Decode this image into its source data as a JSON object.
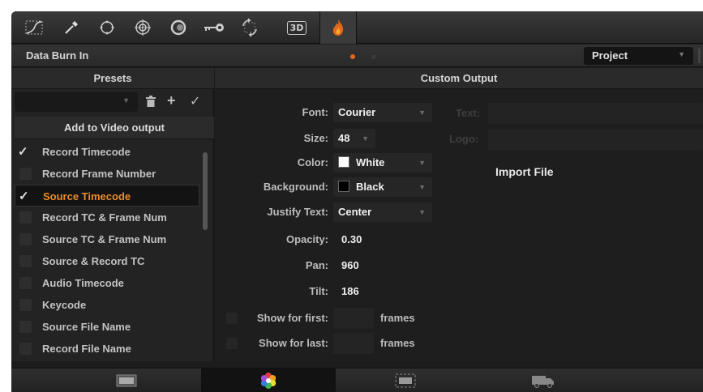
{
  "toolbar": {
    "tools": [
      {
        "icon": "curves-icon"
      },
      {
        "icon": "eyedropper-icon"
      },
      {
        "icon": "window-icon"
      },
      {
        "icon": "tracker-icon"
      },
      {
        "icon": "blur-icon"
      },
      {
        "icon": "key-icon"
      },
      {
        "icon": "sizing-icon"
      },
      {
        "icon": "stereo-3d-icon",
        "label": "3D"
      },
      {
        "icon": "flame-icon"
      }
    ],
    "active_tool": "flame-icon"
  },
  "panel": {
    "title": "Data Burn In",
    "scope_select": "Project"
  },
  "presets": {
    "header": "Presets",
    "selected": ""
  },
  "video_output": {
    "header": "Add to Video output",
    "items": [
      {
        "label": "Record Timecode",
        "checked": true
      },
      {
        "label": "Record Frame Number",
        "checked": false
      },
      {
        "label": "Source Timecode",
        "checked": true
      },
      {
        "label": "Record TC & Frame Num",
        "checked": false
      },
      {
        "label": "Source TC & Frame Num",
        "checked": false
      },
      {
        "label": "Source & Record TC",
        "checked": false
      },
      {
        "label": "Audio Timecode",
        "checked": false
      },
      {
        "label": "Keycode",
        "checked": false
      },
      {
        "label": "Source File Name",
        "checked": false
      },
      {
        "label": "Record File Name",
        "checked": false
      }
    ]
  },
  "custom_output": {
    "header": "Custom Output",
    "font_label": "Font:",
    "font_value": "Courier",
    "size_label": "Size:",
    "size_value": "48",
    "color_label": "Color:",
    "color_value": "White",
    "color_hex": "#ffffff",
    "background_label": "Background:",
    "background_value": "Black",
    "background_hex": "#000000",
    "justify_label": "Justify Text:",
    "justify_value": "Center",
    "opacity_label": "Opacity:",
    "opacity_value": "0.30",
    "pan_label": "Pan:",
    "pan_value": "960",
    "tilt_label": "Tilt:",
    "tilt_value": "186",
    "show_first_label": "Show for first:",
    "show_first_unit": "frames",
    "show_last_label": "Show for last:",
    "show_last_unit": "frames",
    "text_label": "Text:",
    "logo_label": "Logo:",
    "import_label": "Import File"
  },
  "bottom_pages": [
    {
      "icon": "media-page-icon"
    },
    {
      "icon": "color-page-icon",
      "active": true
    },
    {
      "icon": "edit-page-icon"
    },
    {
      "icon": "deliver-page-icon"
    }
  ],
  "colors": {
    "accent": "#e4681c",
    "selected_text": "#e98a2c"
  }
}
